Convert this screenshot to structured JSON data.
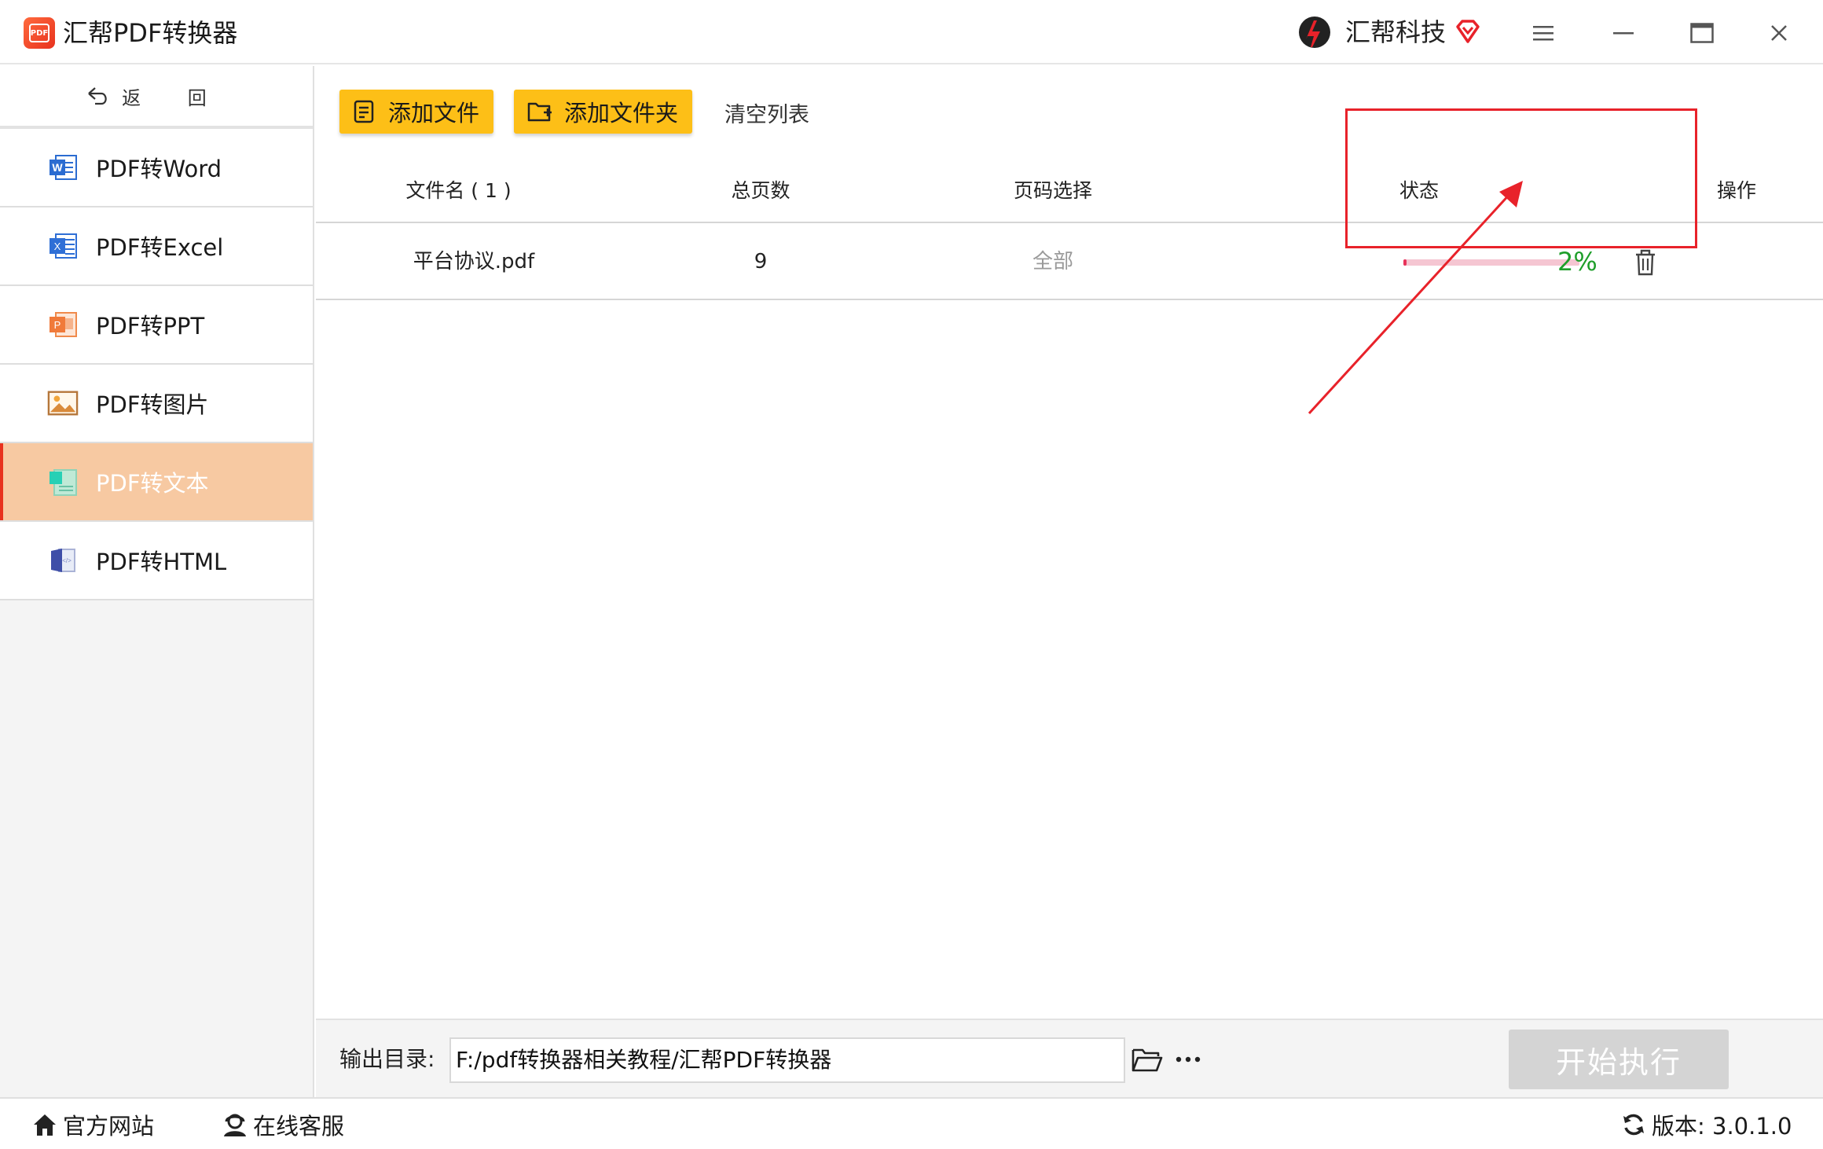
{
  "window": {
    "app_title": "汇帮PDF转换器",
    "app_logo_text": "PDF",
    "brand_name": "汇帮科技"
  },
  "sidebar": {
    "back_label": "返 回",
    "items": [
      {
        "label": "PDF转Word",
        "icon": "word-icon",
        "active": false
      },
      {
        "label": "PDF转Excel",
        "icon": "excel-icon",
        "active": false
      },
      {
        "label": "PDF转PPT",
        "icon": "ppt-icon",
        "active": false
      },
      {
        "label": "PDF转图片",
        "icon": "image-icon",
        "active": false
      },
      {
        "label": "PDF转文本",
        "icon": "text-icon",
        "active": true
      },
      {
        "label": "PDF转HTML",
        "icon": "html-icon",
        "active": false
      }
    ]
  },
  "toolbar": {
    "add_file": "添加文件",
    "add_folder": "添加文件夹",
    "clear_list": "清空列表"
  },
  "table": {
    "headers": {
      "filename": "文件名 ( 1 )",
      "total_pages": "总页数",
      "page_select": "页码选择",
      "status": "状态",
      "action": "操作"
    },
    "rows": [
      {
        "filename": "平台协议.pdf",
        "total_pages": "9",
        "page_select": "全部",
        "progress_percent": 2,
        "progress_text": "2%"
      }
    ]
  },
  "output": {
    "label": "输出目录:",
    "path": "F:/pdf转换器相关教程/汇帮PDF转换器",
    "start_button": "开始执行"
  },
  "footer": {
    "website": "官方网站",
    "support": "在线客服",
    "version": "版本:  3.0.1.0"
  },
  "colors": {
    "accent": "#fdbf17",
    "active_nav": "#f7c9a2",
    "progress_fill": "#e8325a",
    "progress_track": "#f5c6d2",
    "progress_text": "#1e9e2a",
    "highlight": "#e8222a"
  }
}
